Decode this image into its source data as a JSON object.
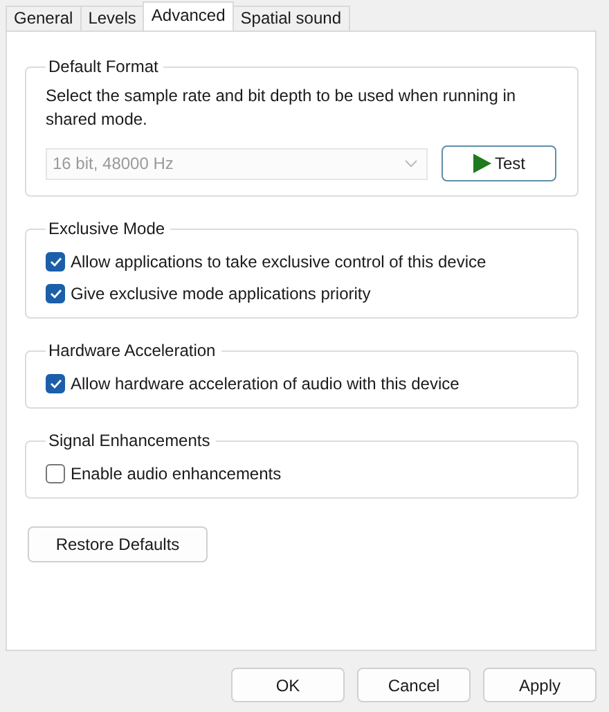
{
  "tabs": [
    {
      "label": "General",
      "selected": false
    },
    {
      "label": "Levels",
      "selected": false
    },
    {
      "label": "Advanced",
      "selected": true
    },
    {
      "label": "Spatial sound",
      "selected": false
    }
  ],
  "default_format": {
    "title": "Default Format",
    "description": "Select the sample rate and bit depth to be used when running in shared mode.",
    "format": {
      "value": "16 bit, 48000 Hz",
      "disabled": true
    },
    "test_button": "Test"
  },
  "groups": [
    {
      "title": "Exclusive Mode",
      "options": [
        {
          "label": "Allow applications to take exclusive control of this device",
          "checked": true
        },
        {
          "label": "Give exclusive mode applications priority",
          "checked": true
        }
      ]
    },
    {
      "title": "Hardware Acceleration",
      "options": [
        {
          "label": "Allow hardware acceleration of audio with this device",
          "checked": true
        }
      ]
    },
    {
      "title": "Signal Enhancements",
      "options": [
        {
          "label": "Enable audio enhancements",
          "checked": false
        }
      ]
    }
  ],
  "restore_button": "Restore Defaults",
  "buttons": [
    "OK",
    "Cancel",
    "Apply"
  ]
}
